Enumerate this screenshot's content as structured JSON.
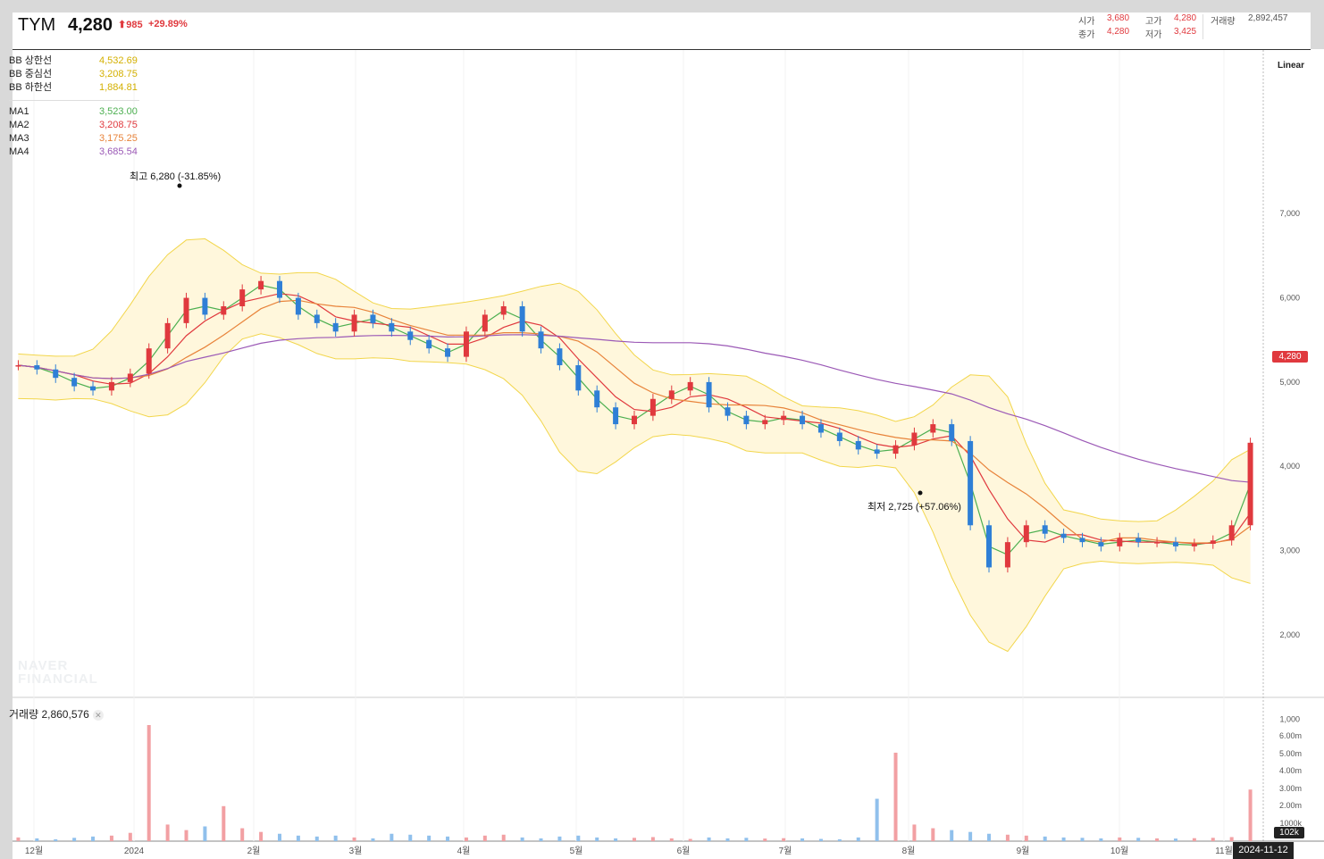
{
  "header": {
    "symbol": "TYM",
    "price": "4,280",
    "change": "985",
    "change_pct": "+29.89%",
    "open_label": "시가",
    "open": "3,680",
    "high_label": "고가",
    "high": "4,280",
    "volume_label": "거래량",
    "volume": "2,892,457",
    "close_label": "종가",
    "close": "4,280",
    "low_label": "저가",
    "low": "3,425"
  },
  "legend": {
    "bb": [
      {
        "name": "BB 상한선",
        "value": "4,532.69",
        "color": "#d4b000"
      },
      {
        "name": "BB 중심선",
        "value": "3,208.75",
        "color": "#d4b000"
      },
      {
        "name": "BB 하한선",
        "value": "1,884.81",
        "color": "#d4b000"
      }
    ],
    "ma": [
      {
        "name": "MA1",
        "value": "3,523.00",
        "color": "#4caf50"
      },
      {
        "name": "MA2",
        "value": "3,208.75",
        "color": "#e0393e"
      },
      {
        "name": "MA3",
        "value": "3,175.25",
        "color": "#e8833a"
      },
      {
        "name": "MA4",
        "value": "3,685.54",
        "color": "#9b59b6"
      }
    ]
  },
  "scale_mode": "Linear",
  "price_tag": "4,280",
  "volume_panel": {
    "label": "거래량 2,860,576",
    "tag": "102k"
  },
  "date_tag": "2024-11-12",
  "annotations": {
    "high": "최고 6,280 (-31.85%)",
    "low": "최저 2,725 (+57.06%)"
  },
  "watermark": [
    "NAVER",
    "FINANCIAL"
  ],
  "colors": {
    "up": "#e0393e",
    "down": "#2f7fd6",
    "band_fill": "#fff7dc",
    "band_line": "#f2d64b"
  },
  "chart_data": {
    "type": "candlestick",
    "x_ticks": [
      "12월",
      "2024",
      "2월",
      "3월",
      "4월",
      "5월",
      "6월",
      "7월",
      "8월",
      "9월",
      "10월",
      "11월"
    ],
    "price_ticks": [
      "7,000",
      "6,000",
      "5,000",
      "4,000",
      "3,000",
      "2,000",
      "1,000"
    ],
    "volume_ticks": [
      "6.00m",
      "5.00m",
      "4.00m",
      "3.00m",
      "2.00m",
      "1000k"
    ],
    "ylim": [
      0,
      7800
    ],
    "series": [
      {
        "name": "Close",
        "values": [
          5200,
          5150,
          5050,
          4950,
          4900,
          5000,
          5100,
          5400,
          5700,
          6000,
          5800,
          5900,
          6100,
          6200,
          6000,
          5800,
          5700,
          5600,
          5800,
          5700,
          5600,
          5500,
          5400,
          5300,
          5600,
          5800,
          5900,
          5600,
          5400,
          5200,
          4900,
          4700,
          4500,
          4600,
          4800,
          4900,
          5000,
          4700,
          4600,
          4500,
          4550,
          4600,
          4500,
          4400,
          4300,
          4200,
          4150,
          4250,
          4400,
          4500,
          4300,
          3300,
          2800,
          3100,
          3300,
          3200,
          3150,
          3100,
          3050,
          3150,
          3100,
          3100,
          3050,
          3080,
          3120,
          3300,
          4280
        ]
      }
    ],
    "annotations": [
      {
        "label": "최고",
        "value": 6280,
        "change_pct": -31.85
      },
      {
        "label": "최저",
        "value": 2725,
        "change_pct": 57.06
      }
    ],
    "indicators": {
      "BB_upper": 4532.69,
      "BB_middle": 3208.75,
      "BB_lower": 1884.81,
      "MA1": 3523.0,
      "MA2": 3208.75,
      "MA3": 3175.25,
      "MA4": 3685.54
    },
    "volume": [
      200,
      150,
      100,
      180,
      250,
      300,
      450,
      6300,
      900,
      600,
      800,
      1900,
      700,
      500,
      400,
      300,
      250,
      300,
      200,
      150,
      400,
      350,
      300,
      250,
      200,
      300,
      350,
      200,
      150,
      250,
      300,
      200,
      150,
      180,
      220,
      150,
      120,
      200,
      150,
      180,
      140,
      160,
      150,
      120,
      100,
      200,
      2300,
      4800,
      900,
      700,
      600,
      500,
      400,
      350,
      300,
      250,
      200,
      180,
      150,
      200,
      180,
      150,
      140,
      160,
      180,
      220,
      2800
    ]
  }
}
